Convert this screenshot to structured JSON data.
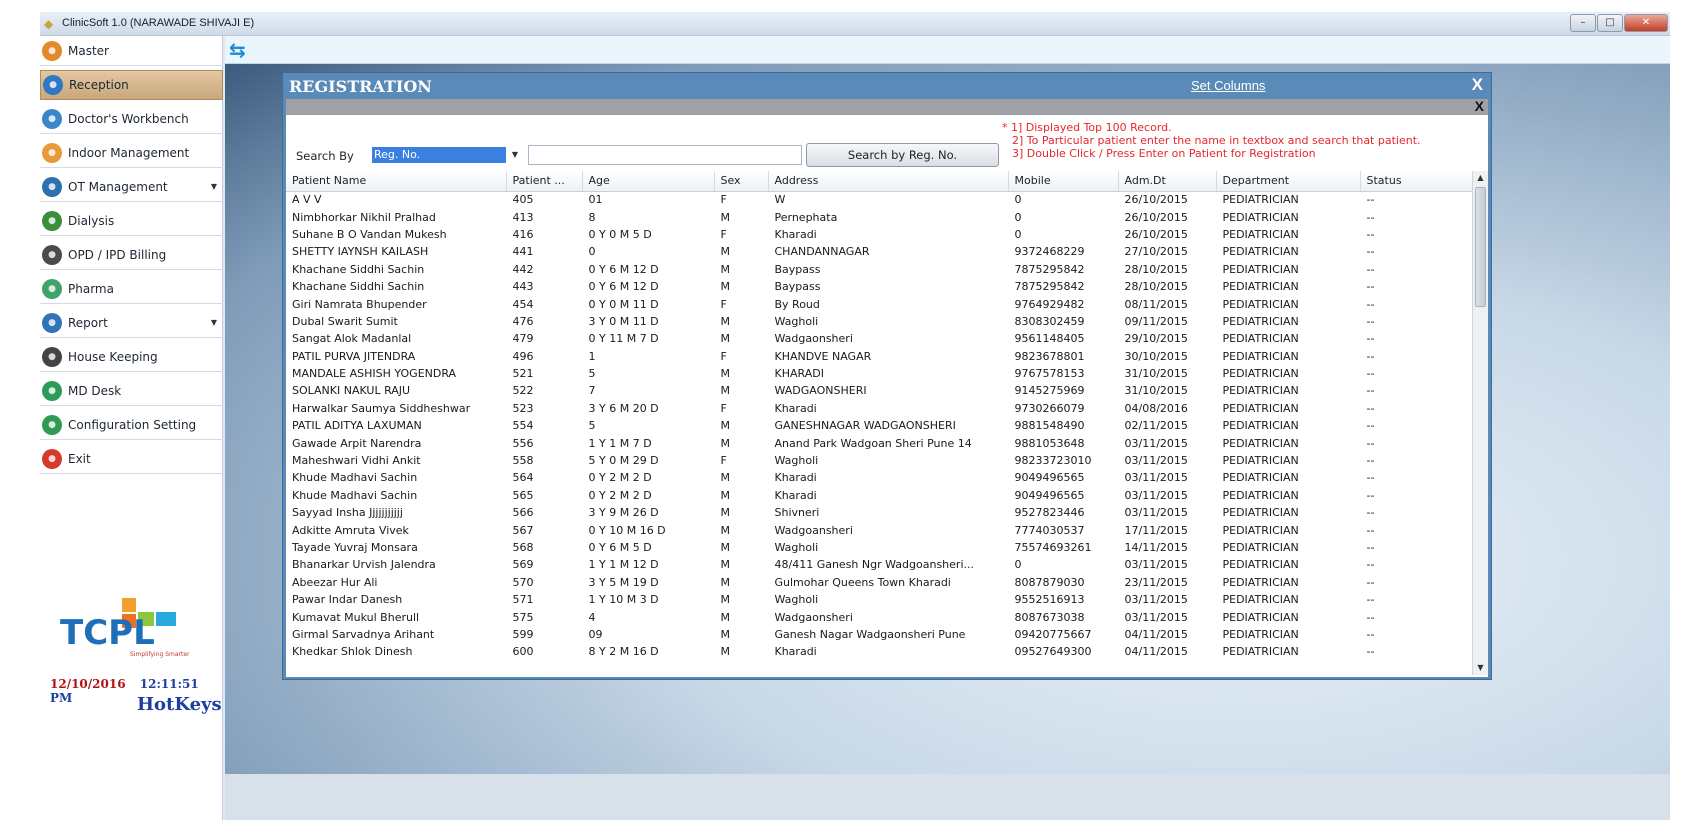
{
  "window": {
    "title": "ClinicSoft 1.0  (NARAWADE SHIVAJI E)"
  },
  "sidebar": {
    "items": [
      {
        "label": "Master",
        "icon": "master-icon",
        "color": "#e28a2b",
        "active": false,
        "arrow": false
      },
      {
        "label": "Reception",
        "icon": "reception-icon",
        "color": "#2f78c4",
        "active": true,
        "arrow": false
      },
      {
        "label": "Doctor's Workbench",
        "icon": "doctor-icon",
        "color": "#3a86c8",
        "active": false,
        "arrow": false
      },
      {
        "label": "Indoor Management",
        "icon": "indoor-icon",
        "color": "#e79a3a",
        "active": false,
        "arrow": false
      },
      {
        "label": "OT Management",
        "icon": "ot-icon",
        "color": "#2d6fb0",
        "active": false,
        "arrow": true
      },
      {
        "label": "Dialysis",
        "icon": "dialysis-icon",
        "color": "#3a8f3a",
        "active": false,
        "arrow": false
      },
      {
        "label": "OPD / IPD Billing",
        "icon": "billing-icon",
        "color": "#4b4b4b",
        "active": false,
        "arrow": false
      },
      {
        "label": "Pharma",
        "icon": "pharma-icon",
        "color": "#3fa36a",
        "active": false,
        "arrow": false
      },
      {
        "label": "Report",
        "icon": "report-icon",
        "color": "#3273b8",
        "active": false,
        "arrow": true
      },
      {
        "label": "House Keeping",
        "icon": "housekeeping-icon",
        "color": "#444444",
        "active": false,
        "arrow": false
      },
      {
        "label": "MD Desk",
        "icon": "mddesk-icon",
        "color": "#2e9a58",
        "active": false,
        "arrow": false
      },
      {
        "label": "Configuration Setting",
        "icon": "config-icon",
        "color": "#2f9a52",
        "active": false,
        "arrow": false
      },
      {
        "label": "Exit",
        "icon": "exit-icon",
        "color": "#d53a2a",
        "active": false,
        "arrow": false
      }
    ],
    "date": "12/10/2016",
    "time": "12:11:51 PM",
    "hotkeys_label": "HotKeys"
  },
  "dialog": {
    "title": "REGISTRATION",
    "set_columns_label": "Set Columns",
    "close_label": "X",
    "inner_close_label": "X",
    "notes": [
      "* 1] Displayed Top 100 Record.",
      "2] To Particular patient enter the name in textbox and search that patient.",
      "3] Double Click / Press Enter on Patient for Registration"
    ],
    "search_by_label": "Search By",
    "search_by_value": "Reg. No.",
    "search_text": "",
    "search_button_label": "Search by Reg. No."
  },
  "table": {
    "columns": [
      "Patient Name",
      "Patient ...",
      "Age",
      "Sex",
      "Address",
      "Mobile",
      "Adm.Dt",
      "Department",
      "Status"
    ],
    "rows": [
      [
        "A V V",
        "405",
        "01",
        "F",
        "W",
        "0",
        "26/10/2015",
        "PEDIATRICIAN",
        "--"
      ],
      [
        "Nimbhorkar Nikhil Pralhad",
        "413",
        "8",
        "M",
        "Pernephata",
        "0",
        "26/10/2015",
        "PEDIATRICIAN",
        "--"
      ],
      [
        "Suhane B O Vandan Mukesh",
        "416",
        "0 Y 0 M 5 D",
        "F",
        "Kharadi",
        "0",
        "26/10/2015",
        "PEDIATRICIAN",
        "--"
      ],
      [
        "SHETTY IAYNSH KAILASH",
        "441",
        "0",
        "M",
        "CHANDANNAGAR",
        "9372468229",
        "27/10/2015",
        "PEDIATRICIAN",
        "--"
      ],
      [
        "Khachane Siddhi Sachin",
        "442",
        "0 Y 6 M 12 D",
        "M",
        "Baypass",
        "7875295842",
        "28/10/2015",
        "PEDIATRICIAN",
        "--"
      ],
      [
        "Khachane Siddhi Sachin",
        "443",
        "0 Y 6 M 12 D",
        "M",
        "Baypass",
        "7875295842",
        "28/10/2015",
        "PEDIATRICIAN",
        "--"
      ],
      [
        "Giri Namrata Bhupender",
        "454",
        "0 Y 0 M 11 D",
        "F",
        "By Roud",
        "9764929482",
        "08/11/2015",
        "PEDIATRICIAN",
        "--"
      ],
      [
        "Dubal Swarit Sumit",
        "476",
        "3 Y 0 M 11 D",
        "M",
        "Wagholi",
        "8308302459",
        "09/11/2015",
        "PEDIATRICIAN",
        "--"
      ],
      [
        "Sangat Alok Madanlal",
        "479",
        "0 Y 11 M 7 D",
        "M",
        "Wadgaonsheri",
        "9561148405",
        "29/10/2015",
        "PEDIATRICIAN",
        "--"
      ],
      [
        "PATIL PURVA JITENDRA",
        "496",
        "1",
        "F",
        "KHANDVE NAGAR",
        "9823678801",
        "30/10/2015",
        "PEDIATRICIAN",
        "--"
      ],
      [
        "MANDALE ASHISH YOGENDRA",
        "521",
        "5",
        "M",
        "KHARADI",
        "9767578153",
        "31/10/2015",
        "PEDIATRICIAN",
        "--"
      ],
      [
        "SOLANKI NAKUL RAJU",
        "522",
        "7",
        "M",
        "WADGAONSHERI",
        "9145275969",
        "31/10/2015",
        "PEDIATRICIAN",
        "--"
      ],
      [
        "Harwalkar Saumya Siddheshwar",
        "523",
        "3 Y 6 M 20 D",
        "F",
        "Kharadi",
        "9730266079",
        "04/08/2016",
        "PEDIATRICIAN",
        "--"
      ],
      [
        "PATIL ADITYA LAXUMAN",
        "554",
        "5",
        "M",
        "GANESHNAGAR WADGAONSHERI",
        "9881548490",
        "02/11/2015",
        "PEDIATRICIAN",
        "--"
      ],
      [
        "Gawade Arpit Narendra",
        "556",
        "1 Y 1 M 7 D",
        "M",
        "Anand Park Wadgoan Sheri Pune 14",
        "9881053648",
        "03/11/2015",
        "PEDIATRICIAN",
        "--"
      ],
      [
        "Maheshwari Vidhi Ankit",
        "558",
        "5 Y 0 M 29 D",
        "F",
        "Wagholi",
        "98233723010",
        "03/11/2015",
        "PEDIATRICIAN",
        "--"
      ],
      [
        "Khude Madhavi Sachin",
        "564",
        "0 Y 2 M 2 D",
        "M",
        "Kharadi",
        "9049496565",
        "03/11/2015",
        "PEDIATRICIAN",
        "--"
      ],
      [
        "Khude Madhavi Sachin",
        "565",
        "0 Y 2 M 2 D",
        "M",
        "Kharadi",
        "9049496565",
        "03/11/2015",
        "PEDIATRICIAN",
        "--"
      ],
      [
        "Sayyad Insha Jjjjjjjjjjj",
        "566",
        "3 Y 9 M 26 D",
        "M",
        "Shivneri",
        "9527823446",
        "03/11/2015",
        "PEDIATRICIAN",
        "--"
      ],
      [
        "Adkitte Amruta Vivek",
        "567",
        "0 Y 10 M 16 D",
        "M",
        "Wadgoansheri",
        "7774030537",
        "17/11/2015",
        "PEDIATRICIAN",
        "--"
      ],
      [
        "Tayade Yuvraj Monsara",
        "568",
        "0 Y 6 M 5 D",
        "M",
        "Wagholi",
        "75574693261",
        "14/11/2015",
        "PEDIATRICIAN",
        "--"
      ],
      [
        "Bhanarkar Urvish Jalendra",
        "569",
        "1 Y 1 M 12 D",
        "M",
        "48/411 Ganesh Ngr Wadgoansheri...",
        "0",
        "03/11/2015",
        "PEDIATRICIAN",
        "--"
      ],
      [
        "Abeezar Hur Ali",
        "570",
        "3 Y 5 M 19 D",
        "M",
        "Gulmohar Queens  Town  Kharadi",
        "8087879030",
        "23/11/2015",
        "PEDIATRICIAN",
        "--"
      ],
      [
        "Pawar Indar Danesh",
        "571",
        "1 Y 10 M 3 D",
        "M",
        "Wagholi",
        "9552516913",
        "03/11/2015",
        "PEDIATRICIAN",
        "--"
      ],
      [
        "Kumavat Mukul Bherull",
        "575",
        "4",
        "M",
        "Wadgaonsheri",
        "8087673038",
        "03/11/2015",
        "PEDIATRICIAN",
        "--"
      ],
      [
        "Girmal Sarvadnya Arihant",
        "599",
        "09",
        "M",
        "Ganesh Nagar Wadgaonsheri Pune",
        "09420775667",
        "04/11/2015",
        "PEDIATRICIAN",
        "--"
      ],
      [
        "Khedkar Shlok Dinesh",
        "600",
        "8 Y 2 M 16 D",
        "M",
        "Kharadi",
        "09527649300",
        "04/11/2015",
        "PEDIATRICIAN",
        "--"
      ]
    ]
  },
  "colors": {
    "dialog_header": "#5a8ab8",
    "active_nav": "#c9a77a",
    "notes_text": "#e8262b",
    "date_text": "#b01212",
    "time_text": "#1c3fa0"
  }
}
